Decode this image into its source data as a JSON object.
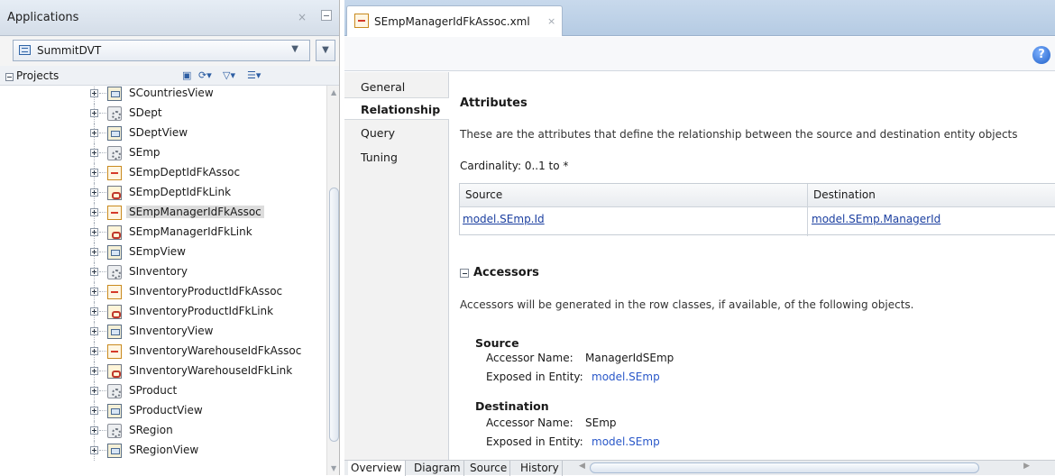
{
  "left_panel": {
    "title": "Applications",
    "close_glyph": "×",
    "app_select": {
      "value": "SummitDVT",
      "arrow": "▼"
    },
    "menu_arrow": "▼",
    "projects_label": "Projects",
    "tree_items": [
      {
        "label": "SCountriesView",
        "icon": "view-object-icon"
      },
      {
        "label": "SDept",
        "icon": "entity-object-icon"
      },
      {
        "label": "SDeptView",
        "icon": "view-object-icon"
      },
      {
        "label": "SEmp",
        "icon": "entity-object-icon"
      },
      {
        "label": "SEmpDeptIdFkAssoc",
        "icon": "association-icon"
      },
      {
        "label": "SEmpDeptIdFkLink",
        "icon": "view-link-icon"
      },
      {
        "label": "SEmpManagerIdFkAssoc",
        "icon": "association-icon",
        "selected": true
      },
      {
        "label": "SEmpManagerIdFkLink",
        "icon": "view-link-icon"
      },
      {
        "label": "SEmpView",
        "icon": "view-object-icon"
      },
      {
        "label": "SInventory",
        "icon": "entity-object-icon"
      },
      {
        "label": "SInventoryProductIdFkAssoc",
        "icon": "association-icon"
      },
      {
        "label": "SInventoryProductIdFkLink",
        "icon": "view-link-icon"
      },
      {
        "label": "SInventoryView",
        "icon": "view-object-icon"
      },
      {
        "label": "SInventoryWarehouseIdFkAssoc",
        "icon": "association-icon"
      },
      {
        "label": "SInventoryWarehouseIdFkLink",
        "icon": "view-link-icon"
      },
      {
        "label": "SProduct",
        "icon": "entity-object-icon"
      },
      {
        "label": "SProductView",
        "icon": "view-object-icon"
      },
      {
        "label": "SRegion",
        "icon": "entity-object-icon"
      },
      {
        "label": "SRegionView",
        "icon": "view-object-icon"
      }
    ]
  },
  "editor": {
    "file_tab": {
      "label": "SEmpManagerIdFkAssoc.xml",
      "close_glyph": "×"
    },
    "help_glyph": "?",
    "nav_items": [
      {
        "label": "General"
      },
      {
        "label": "Relationship",
        "active": true
      },
      {
        "label": "Query"
      },
      {
        "label": "Tuning"
      }
    ],
    "attributes": {
      "heading": "Attributes",
      "description": "These are the attributes that define the relationship between the source and destination entity objects",
      "cardinality": "Cardinality:  0..1 to *",
      "table": {
        "headers": [
          "Source",
          "Destination"
        ],
        "rows": [
          [
            "model.SEmp.Id",
            "model.SEmp.ManagerId"
          ]
        ]
      }
    },
    "accessors": {
      "heading": "Accessors",
      "description": "Accessors will be generated in the row classes, if available, of the following objects.",
      "source": {
        "heading": "Source",
        "accessor_key": "Accessor Name:",
        "accessor_value": "ManagerIdSEmp",
        "exposed_key": "Exposed in Entity:",
        "exposed_value": "model.SEmp"
      },
      "destination": {
        "heading": "Destination",
        "accessor_key": "Accessor Name:",
        "accessor_value": "SEmp",
        "exposed_key": "Exposed in Entity:",
        "exposed_value": "model.SEmp"
      }
    },
    "bottom_tabs": [
      {
        "label": "Overview",
        "active": true
      },
      {
        "label": "Diagram"
      },
      {
        "label": "Source"
      },
      {
        "label": "History"
      }
    ]
  }
}
